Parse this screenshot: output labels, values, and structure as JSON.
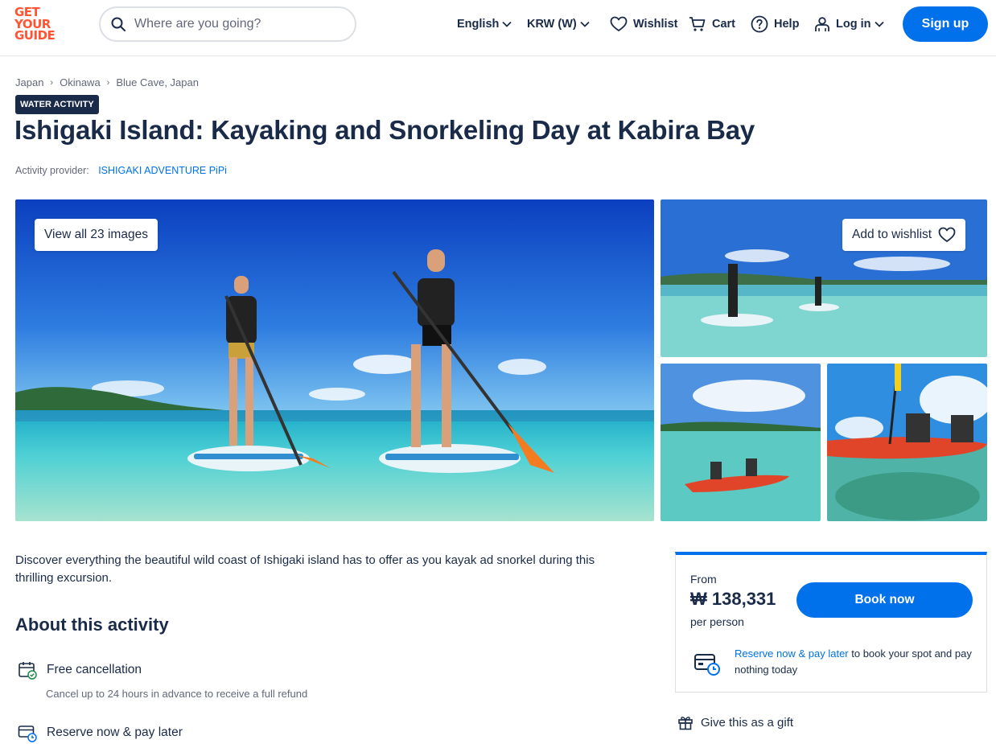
{
  "header": {
    "logo_lines": [
      "GET",
      "YOUR",
      "GUIDE"
    ],
    "search_placeholder": "Where are you going?",
    "language_label": "English",
    "currency_label": "KRW (W)",
    "wishlist_label": "Wishlist",
    "cart_label": "Cart",
    "help_label": "Help",
    "login_label": "Log in",
    "signup_label": "Sign up"
  },
  "breadcrumb": [
    "Japan",
    "Okinawa",
    "Blue Cave, Japan"
  ],
  "badge": "WATER ACTIVITY",
  "title": "Ishigaki Island: Kayaking and Snorkeling Day at Kabira Bay",
  "provider": {
    "label": "Activity provider:",
    "name": "ISHIGAKI ADVENTURE PiPi"
  },
  "gallery": {
    "view_all_label": "View all 23 images",
    "add_wishlist_label": "Add to wishlist"
  },
  "description": "Discover everything the beautiful wild coast of Ishigaki island has to offer as you kayak ad snorkel during this thrilling excursion.",
  "about": {
    "heading": "About this activity",
    "features": [
      {
        "title": "Free cancellation",
        "subtitle": "Cancel up to 24 hours in advance to receive a full refund"
      },
      {
        "title": "Reserve now & pay later"
      }
    ]
  },
  "booking": {
    "from_label": "From",
    "price": "₩ 138,331",
    "per_person": "per person",
    "book_label": "Book now",
    "reserve_link": "Reserve now & pay later",
    "reserve_text": " to book your spot and pay nothing today"
  },
  "gift_label": "Give this as a gift",
  "colors": {
    "brand_orange": "#ff5533",
    "primary_blue": "#0071eb",
    "text_dark": "#1a2b49",
    "text_muted": "#63687a"
  }
}
